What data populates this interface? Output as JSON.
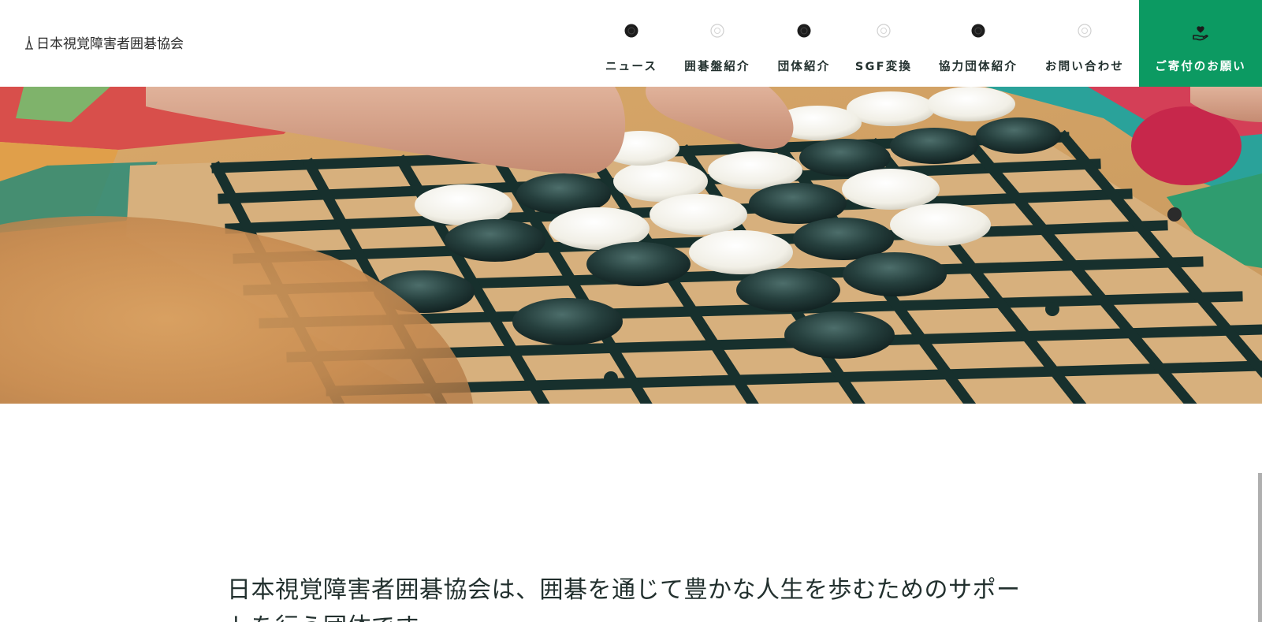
{
  "header": {
    "site_title": "日本視覚障害者囲碁協会",
    "logo_icon": "go-stone-figure-icon"
  },
  "nav": {
    "items": [
      {
        "label": "ニュース",
        "icon": "black-go-stone-icon"
      },
      {
        "label": "囲碁盤紹介",
        "icon": "white-go-stone-icon"
      },
      {
        "label": "団体紹介",
        "icon": "black-go-stone-icon"
      },
      {
        "label": "SGF変換",
        "icon": "white-go-stone-icon"
      },
      {
        "label": "協力団体紹介",
        "icon": "black-go-stone-icon"
      },
      {
        "label": "お問い合わせ",
        "icon": "white-go-stone-icon"
      }
    ],
    "donate": {
      "label": "ご寄付のお願い",
      "icon": "heart-hand-icon"
    }
  },
  "hero": {
    "image": "tactile-go-board-photo"
  },
  "intro": {
    "text": "日本視覚障害者囲碁協会は、囲碁を通じて豊かな人生を歩むためのサポートを行う団体です。"
  },
  "colors": {
    "accent": "#0c9a62",
    "text": "#22302e",
    "background": "#ffffff"
  }
}
